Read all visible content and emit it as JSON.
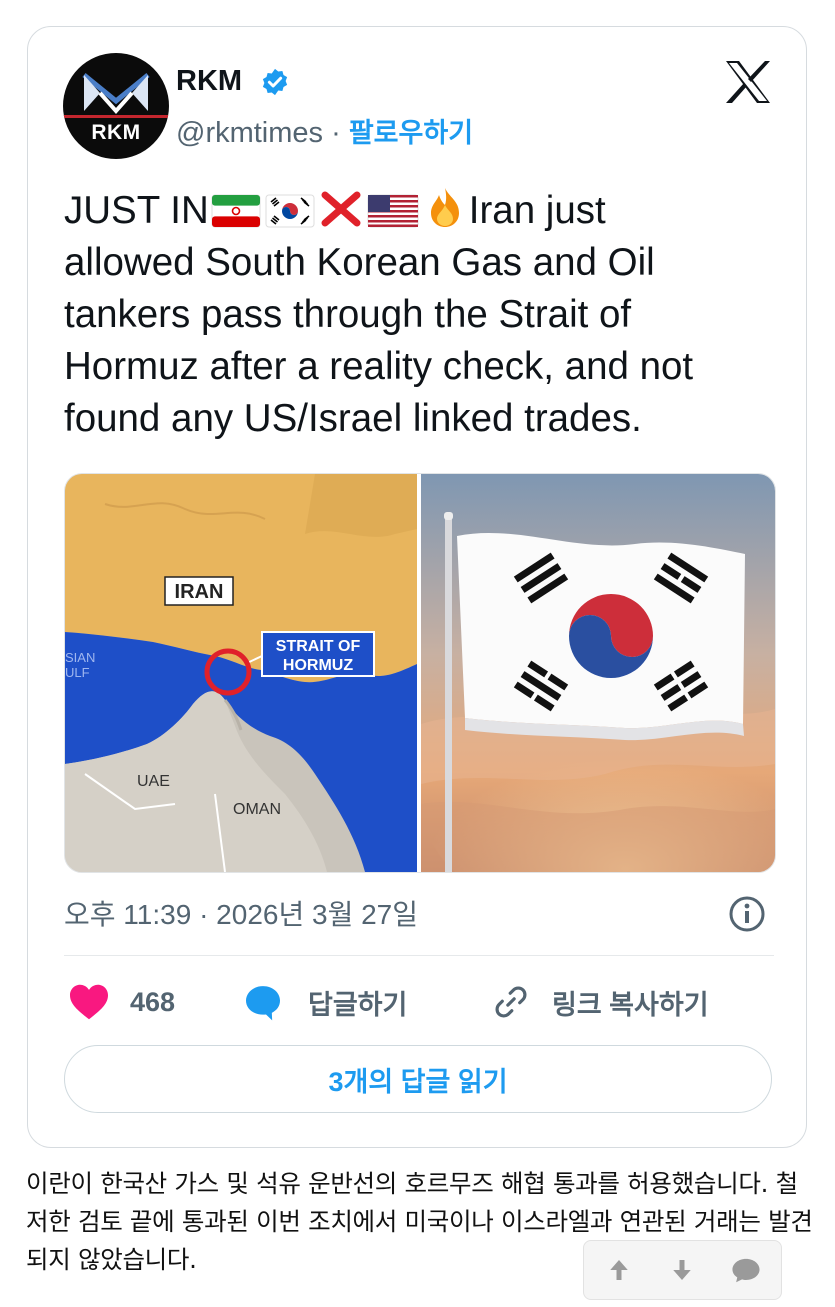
{
  "author": {
    "avatar_text": "RKM",
    "name": "RKM",
    "handle": "@rkmtimes",
    "separator": "·",
    "follow_label": "팔로우하기"
  },
  "brand": {
    "accent": "#1d9bf0",
    "like_color": "#f91880",
    "verified_color": "#1d9bf0"
  },
  "tweet": {
    "lead": "JUST IN",
    "emojis": [
      "iran-flag",
      "south-korea-flag",
      "cross-mark",
      "us-flag",
      "fire"
    ],
    "line1_tail": "Iran just",
    "body": "allowed South Korean Gas and Oil\ntankers pass through the Strait of\nHormuz after a reality check, and not\nfound any US/Israel linked trades."
  },
  "media": {
    "map_labels": {
      "iran": "IRAN",
      "strait_line1": "STRAIT OF",
      "strait_line2": "HORMUZ",
      "gulf_line1": "SIAN",
      "gulf_line2": "ULF",
      "uae": "UAE",
      "oman": "OMAN"
    }
  },
  "timestamp": "오후 11:39 · 2026년 3월 27일",
  "actions": {
    "like_count": "468",
    "reply_label": "답글하기",
    "copy_link_label": "링크 복사하기"
  },
  "read_replies_label": "3개의 답글 읽기",
  "caption": "이란이 한국산 가스 및 석유 운반선의 호르무즈 해협 통과를 허용했습니다. 철저한 검토 끝에 통과된 이번 조치에서 미국이나 이스라엘과 연관된 거래는 발견되지 않았습니다.",
  "vote_box": {
    "icons": [
      "upvote-arrow",
      "downvote-arrow",
      "comment-bubble"
    ]
  }
}
